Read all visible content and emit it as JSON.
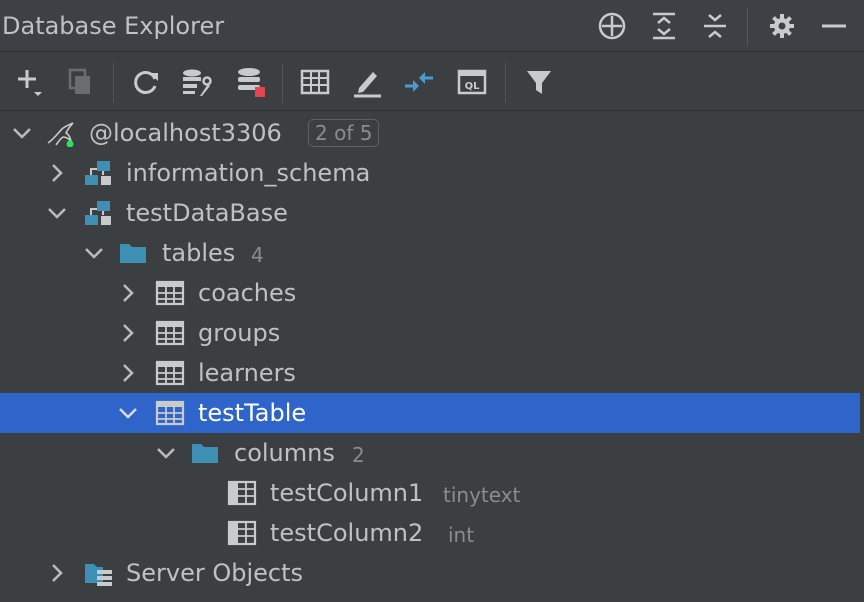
{
  "window": {
    "title": "Database Explorer"
  },
  "title_actions": [
    {
      "name": "locate-icon"
    },
    {
      "name": "expand-all-icon"
    },
    {
      "name": "collapse-all-icon"
    },
    {
      "name": "gear-icon"
    },
    {
      "name": "minimize-icon"
    }
  ],
  "toolbar": [
    {
      "name": "add-icon"
    },
    {
      "name": "duplicate-icon"
    },
    {
      "name": "refresh-icon"
    },
    {
      "name": "data-source-properties-icon"
    },
    {
      "name": "disconnect-icon"
    },
    {
      "name": "table-view-icon"
    },
    {
      "name": "edit-icon"
    },
    {
      "name": "jump-to-source-icon"
    },
    {
      "name": "query-console-icon"
    },
    {
      "name": "filter-icon"
    }
  ],
  "tree": {
    "connection": {
      "label": "@localhost3306",
      "badge": "2 of 5"
    },
    "info_schema": {
      "label": "information_schema"
    },
    "database": {
      "label": "testDataBase"
    },
    "tables_folder": {
      "label": "tables",
      "count": "4"
    },
    "tables": [
      {
        "label": "coaches"
      },
      {
        "label": "groups"
      },
      {
        "label": "learners"
      },
      {
        "label": "testTable"
      }
    ],
    "columns_folder": {
      "label": "columns",
      "count": "2"
    },
    "columns": [
      {
        "label": "testColumn1",
        "type": "tinytext"
      },
      {
        "label": "testColumn2",
        "type": "int"
      }
    ],
    "server_objects": {
      "label": "Server Objects"
    }
  },
  "colors": {
    "background": "#3c3f41",
    "selection": "#2f65ca",
    "folder": "#3d8fb4",
    "schema": "#3d8fb4",
    "status_green": "#2ee05a",
    "disconnect_red": "#e0484d"
  }
}
